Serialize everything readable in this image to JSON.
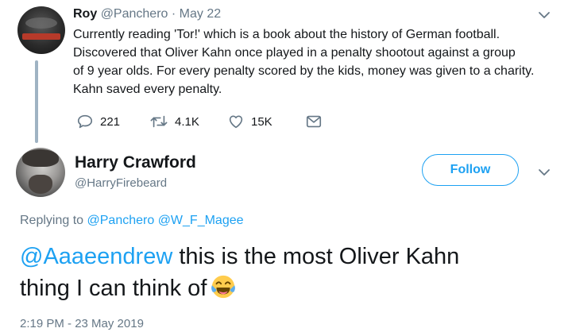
{
  "parent_tweet": {
    "name": "Roy",
    "handle": "@Panchero",
    "separator": "·",
    "date": "May 22",
    "text_lines": [
      "Currently reading 'Tor!' which is a book about the history of German football.",
      "Discovered that Oliver Kahn once played in a penalty shootout against a group",
      "of 9 year olds. For every penalty scored by the kids, money was given to a charity.",
      "Kahn saved every penalty."
    ],
    "actions": {
      "reply_count": "221",
      "retweet_count": "4.1K",
      "like_count": "15K"
    }
  },
  "tweet": {
    "name": "Harry Crawford",
    "handle": "@HarryFirebeard",
    "follow_label": "Follow",
    "replying_prefix": "Replying to",
    "replying_to": [
      "@Panchero",
      "@W_F_Magee"
    ],
    "mention": "@Aaaeendrew",
    "text_part1": " this is the most Oliver Kahn",
    "text_part2": "thing I can think of",
    "emoji_icon": "face-with-tears-of-joy-icon",
    "timestamp": "2:19 PM - 23 May 2019"
  },
  "colors": {
    "accent": "#1da1f2",
    "muted": "#657786",
    "text": "#14171a",
    "thread_line": "#9fb3c3"
  }
}
